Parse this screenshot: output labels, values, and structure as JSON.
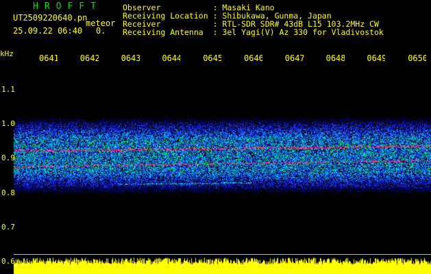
{
  "app_title": "HROFFT",
  "file_name": "UT2509220640.pn",
  "mode_label": "meteor",
  "date_time": "25.09.22 06:40",
  "meteor_count": "0.",
  "info": [
    {
      "label": "Observer           ",
      "value": ": Masaki Kano"
    },
    {
      "label": "Receiving Location ",
      "value": ": Shibukawa, Gunma, Japan"
    },
    {
      "label": "Receiver           ",
      "value": ": RTL-SDR SDR# 43dB L15 103.2MHz CW"
    },
    {
      "label": "Receiving Antenna  ",
      "value": ": 3el Yagi(V) Az 330 for Vladivostok"
    }
  ],
  "freq_unit": "kHz",
  "time_labels": [
    "0641",
    "0642",
    "0643",
    "0644",
    "0645",
    "0646",
    "0647",
    "0648",
    "0649",
    "0650"
  ],
  "freq_labels": [
    "1.1",
    "1.0",
    "0.9",
    "0.8",
    "0.7",
    "0.6"
  ],
  "colors": {
    "text": "#ffff00",
    "title": "#00e000",
    "background": "#000000"
  }
}
